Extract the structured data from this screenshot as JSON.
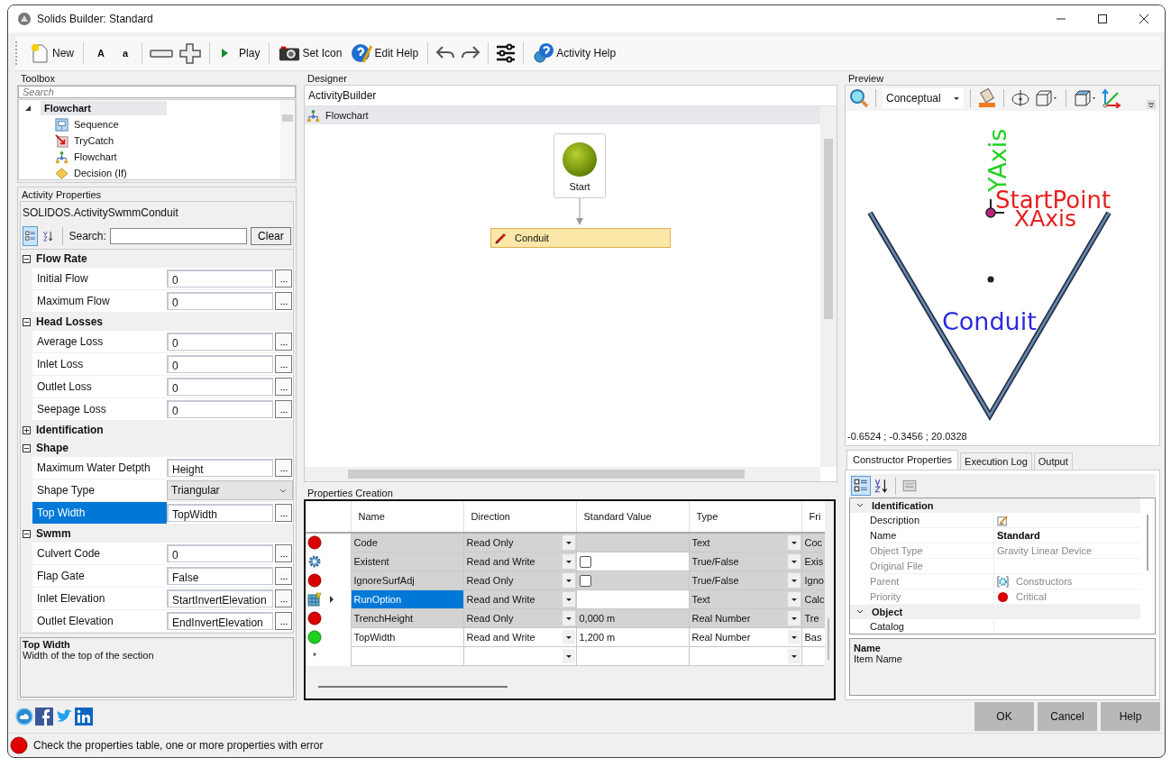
{
  "window": {
    "title": "Solids Builder: Standard"
  },
  "toolbar": [
    {
      "label": "New"
    },
    {
      "label": "A"
    },
    {
      "label": "a"
    },
    {
      "label": "Play"
    },
    {
      "label": "Set Icon"
    },
    {
      "label": "Edit Help"
    },
    {
      "label": "Activity Help"
    }
  ],
  "toolbox": {
    "title": "Toolbox",
    "search": {
      "placeholder": "Search"
    },
    "items": [
      {
        "label": "Flowchart",
        "expanded": true,
        "selected": true,
        "children": [
          {
            "label": "Sequence",
            "kind": "sequence"
          },
          {
            "label": "TryCatch",
            "kind": "trycatch"
          },
          {
            "label": "Flowchart",
            "kind": "flowchart"
          },
          {
            "label": "Decision (If)",
            "kind": "decision"
          }
        ]
      }
    ]
  },
  "activity_properties": {
    "title": "Activity Properties",
    "object": "SOLIDOS.ActivitySwmmConduit",
    "search_label": "Search:",
    "clear": "Clear",
    "categories": [
      {
        "name": "Flow Rate",
        "expanded": true,
        "properties": [
          {
            "name": "Initial Flow",
            "value": "0",
            "kind": "text",
            "selected": false
          },
          {
            "name": "Maximum Flow",
            "value": "0",
            "kind": "text",
            "selected": false
          }
        ]
      },
      {
        "name": "Head Losses",
        "expanded": true,
        "properties": [
          {
            "name": "Average Loss",
            "value": "0",
            "kind": "text",
            "selected": false
          },
          {
            "name": "Inlet Loss",
            "value": "0",
            "kind": "text",
            "selected": false
          },
          {
            "name": "Outlet Loss",
            "value": "0",
            "kind": "text",
            "selected": false
          },
          {
            "name": "Seepage Loss",
            "value": "0",
            "kind": "text",
            "selected": false
          }
        ]
      },
      {
        "name": "Identification",
        "expanded": false
      },
      {
        "name": "Shape",
        "expanded": true,
        "properties": [
          {
            "name": "Maximum Water Detpth",
            "value": "Height",
            "kind": "text",
            "selected": false
          },
          {
            "name": "Shape Type",
            "value": "Triangular",
            "kind": "dropdown",
            "selected": false
          },
          {
            "name": "Top Width",
            "value": "TopWidth",
            "kind": "text",
            "selected": true
          }
        ]
      },
      {
        "name": "Swmm",
        "expanded": true,
        "properties": [
          {
            "name": "Culvert Code",
            "value": "0",
            "kind": "text",
            "selected": false
          },
          {
            "name": "Flap Gate",
            "value": "False",
            "kind": "text",
            "selected": false
          },
          {
            "name": "Inlet Elevation",
            "value": "StartInvertElevation",
            "kind": "text",
            "selected": false
          },
          {
            "name": "Outlet Elevation",
            "value": "EndInvertElevation",
            "kind": "text",
            "selected": false
          }
        ]
      }
    ],
    "description": {
      "title": "Top Width",
      "text": "Width of the top of the section"
    }
  },
  "designer": {
    "title": "Designer",
    "breadcrumb": "ActivityBuilder",
    "root": "Flowchart",
    "start": "Start",
    "activity": "Conduit"
  },
  "properties_creation": {
    "title": "Properties Creation",
    "columns": [
      "Name",
      "Direction",
      "Standard Value",
      "Type",
      "Fri"
    ],
    "rows": [
      {
        "kind": "error",
        "name": "Code",
        "direction": "Read Only",
        "type": "Text",
        "column_5": "Coc",
        "locked": true,
        "value_locked": true,
        "selected": false
      },
      {
        "kind": "linked",
        "name": "Existent",
        "direction": "Read and Write",
        "checked": false,
        "type": "True/False",
        "column_5": "Exis",
        "locked": true,
        "value_locked": false,
        "selected": false
      },
      {
        "kind": "error",
        "name": "IgnoreSurfAdj",
        "direction": "Read Only",
        "checked": false,
        "type": "True/False",
        "column_5": "Igno",
        "locked": true,
        "value_locked": true,
        "selected": false
      },
      {
        "kind": "computed",
        "name": "RunOption",
        "direction": "Read and Write",
        "type": "Text",
        "column_5": "Calc",
        "locked": true,
        "value_locked": false,
        "selected": true,
        "current": true
      },
      {
        "kind": "error",
        "name": "TrenchHeight",
        "direction": "Read Only",
        "value": "0,000 m",
        "type": "Real Number",
        "column_5": "Tre",
        "locked": true,
        "value_locked": true,
        "selected": false
      },
      {
        "kind": "ok",
        "name": "TopWidth",
        "direction": "Read and Write",
        "value": "1,200 m",
        "type": "Real Number",
        "column_5": "Bas",
        "locked": false,
        "value_locked": false,
        "selected": false
      },
      {
        "kind": "new",
        "marker": "*",
        "locked": false,
        "value_locked": false,
        "selected": false
      }
    ]
  },
  "preview": {
    "title": "Preview",
    "view_mode": "Conceptual",
    "labels": {
      "y_axis": "YAxis",
      "start_point": "StartPoint",
      "x_axis": "XAxis",
      "conduit": "Conduit"
    },
    "coordinates": "-0.6524 ; -0.3456 ; 20.0328"
  },
  "tabs": [
    {
      "label": "Constructor Properties",
      "selected": true
    },
    {
      "label": "Execution Log",
      "selected": false
    },
    {
      "label": "Output",
      "selected": false
    }
  ],
  "constructor_properties": {
    "categories": [
      {
        "name": "Identification",
        "expanded": true,
        "rows": [
          {
            "name": "Description",
            "kind": "edit",
            "disabled": false
          },
          {
            "name": "Name",
            "kind": "text",
            "value": "Standard",
            "disabled": false,
            "bold": true
          },
          {
            "name": "Object Type",
            "kind": "text",
            "value": "Gravity Linear Device",
            "disabled": true,
            "bold": false
          },
          {
            "name": "Original File",
            "kind": "text",
            "disabled": true
          },
          {
            "name": "Parent",
            "kind": "link",
            "value": "Constructors",
            "disabled": true,
            "bold": false
          },
          {
            "name": "Priority",
            "kind": "priority",
            "value": "Critical",
            "disabled": true,
            "bold": false
          }
        ]
      },
      {
        "name": "Object",
        "expanded": true,
        "rows": [
          {
            "name": "Catalog",
            "kind": "text",
            "disabled": false
          }
        ]
      }
    ],
    "description": {
      "title": "Name",
      "text": "Item Name"
    }
  },
  "buttons": [
    "OK",
    "Cancel",
    "Help"
  ],
  "status_bar": {
    "kind": "error",
    "text": "Check the properties table, one or more properties with error"
  }
}
